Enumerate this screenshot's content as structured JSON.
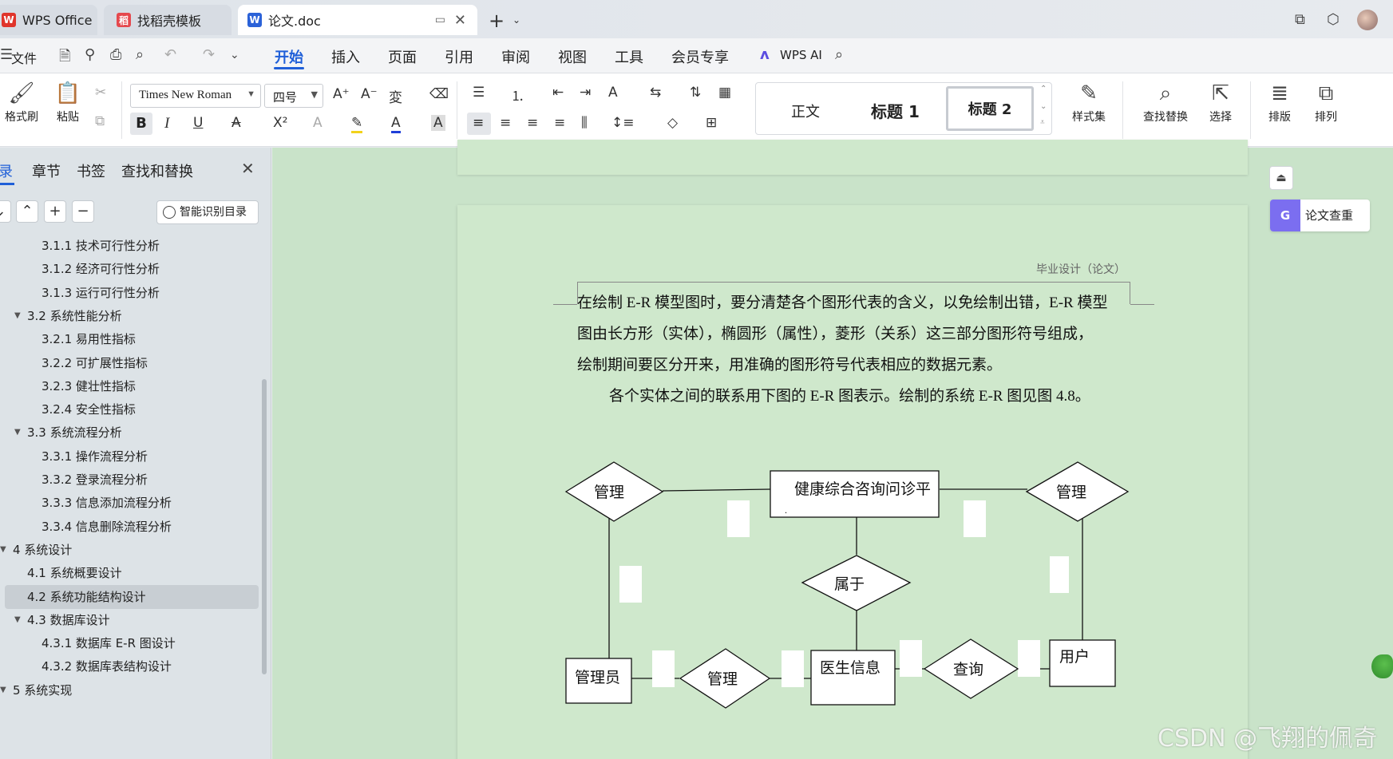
{
  "titlebar": {
    "tabs": [
      {
        "label": "WPS Office",
        "icon": "wps-logo-icon"
      },
      {
        "label": "找稻壳模板",
        "icon": "docer-icon"
      },
      {
        "label": "论文.doc",
        "icon": "word-doc-icon"
      }
    ],
    "new_tab": "+"
  },
  "menubar": {
    "file_label": "文件",
    "items": [
      "开始",
      "插入",
      "页面",
      "引用",
      "审阅",
      "视图",
      "工具",
      "会员专享"
    ],
    "active": "开始",
    "ai_label": "WPS AI"
  },
  "ribbon": {
    "format_painter": "格式刷",
    "paste": "粘贴",
    "font_name": "Times New Roman",
    "font_size": "四号",
    "styles": [
      "正文",
      "标题 1",
      "标题 2"
    ],
    "style_set": "样式集",
    "find_replace": "查找替换",
    "select": "选择",
    "layout": "排版",
    "arrange": "排列"
  },
  "nav": {
    "tabs": [
      "录",
      "章节",
      "书签",
      "查找和替换"
    ],
    "smart_toc": "智能识别目录",
    "items": [
      {
        "text": "3.1.1  技术可行性分析",
        "level": 3
      },
      {
        "text": "3.1.2  经济可行性分析",
        "level": 3
      },
      {
        "text": "3.1.3  运行可行性分析",
        "level": 3
      },
      {
        "text": "3.2  系统性能分析",
        "level": 2,
        "expanded": true
      },
      {
        "text": "3.2.1  易用性指标",
        "level": 3
      },
      {
        "text": "3.2.2  可扩展性指标",
        "level": 3
      },
      {
        "text": "3.2.3  健壮性指标",
        "level": 3
      },
      {
        "text": "3.2.4  安全性指标",
        "level": 3
      },
      {
        "text": "3.3  系统流程分析",
        "level": 2,
        "expanded": true
      },
      {
        "text": "3.3.1  操作流程分析",
        "level": 3
      },
      {
        "text": "3.3.2  登录流程分析",
        "level": 3
      },
      {
        "text": "3.3.3  信息添加流程分析",
        "level": 3
      },
      {
        "text": "3.3.4  信息删除流程分析",
        "level": 3
      },
      {
        "text": "4  系统设计",
        "level": 1,
        "expanded": true
      },
      {
        "text": "4.1  系统概要设计",
        "level": 2
      },
      {
        "text": "4.2  系统功能结构设计",
        "level": 2,
        "selected": true
      },
      {
        "text": "4.3  数据库设计",
        "level": 2,
        "expanded": true
      },
      {
        "text": "4.3.1  数据库 E-R 图设计",
        "level": 3
      },
      {
        "text": "4.3.2  数据库表结构设计",
        "level": 3
      },
      {
        "text": "5  系统实现",
        "level": 1,
        "expanded": true
      }
    ]
  },
  "document": {
    "header": "毕业设计（论文）",
    "para1_line1": "在绘制 E-R 模型图时，要分清楚各个图形代表的含义，以免绘制出错，E-R 模型",
    "para1_line2": "图由长方形（实体），椭圆形（属性），菱形（关系）这三部分图形符号组成，",
    "para1_line3": "绘制期间要区分开来，用准确的图形符号代表相应的数据元素。",
    "para2": "各个实体之间的联系用下图的 E-R 图表示。绘制的系统 E-R 图见图 4.8。",
    "er": {
      "entity_platform": "健康综合咨询问诊平",
      "entity_platform_cont": ".",
      "entity_admin": "管理员",
      "entity_doctor": "医生信息",
      "entity_user": "用户",
      "rel_manage_left": "管理",
      "rel_manage_right": "管理",
      "rel_belong": "属于",
      "rel_manage_bottom": "管理",
      "rel_query": "查询"
    }
  },
  "side": {
    "paper_check": "论文查重"
  },
  "watermark": "CSDN @飞翔的佩奇"
}
